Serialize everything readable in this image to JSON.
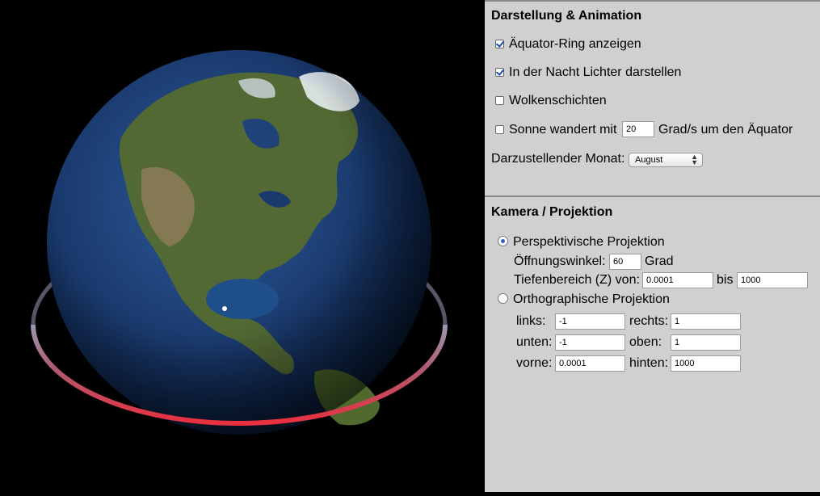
{
  "sections": {
    "display": {
      "title": "Darstellung & Animation",
      "equator_ring": {
        "label": "Äquator-Ring anzeigen",
        "checked": true
      },
      "night_lights": {
        "label": "In der Nacht Lichter darstellen",
        "checked": true
      },
      "clouds": {
        "label": "Wolkenschichten",
        "checked": false
      },
      "sun": {
        "label_before": "Sonne wandert mit",
        "value": "20",
        "label_after": "Grad/s um den Äquator",
        "checked": false
      },
      "month": {
        "label": "Darzustellender Monat:",
        "selected": "August"
      }
    },
    "camera": {
      "title": "Kamera / Projektion",
      "perspective": {
        "label": "Perspektivische Projektion",
        "selected": true
      },
      "fov": {
        "label": "Öffnungswinkel:",
        "value": "60",
        "unit": "Grad"
      },
      "depth": {
        "label": "Tiefenbereich (Z) von:",
        "from": "0.0001",
        "to_label": "bis",
        "to": "1000"
      },
      "ortho": {
        "label": "Orthographische Projektion",
        "selected": false
      },
      "left": {
        "label": "links:",
        "value": "-1"
      },
      "right": {
        "label": "rechts:",
        "value": "1"
      },
      "bottom": {
        "label": "unten:",
        "value": "-1"
      },
      "top": {
        "label": "oben:",
        "value": "1"
      },
      "near": {
        "label": "vorne:",
        "value": "0.0001"
      },
      "far": {
        "label": "hinten:",
        "value": "1000"
      }
    }
  },
  "colors": {
    "ring": "#d8343f",
    "ocean": "#1a3a6e",
    "land": "#4f6a2c"
  }
}
